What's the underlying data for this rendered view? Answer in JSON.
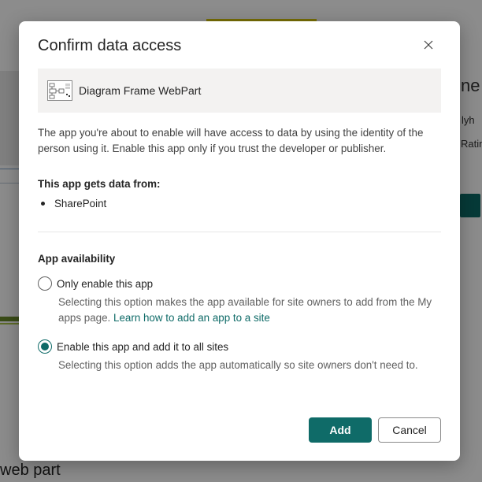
{
  "background": {
    "right_text_1": "ne W",
    "right_text_2": "lyh",
    "right_text_3": "Ratin",
    "bottom_text": "web part"
  },
  "dialog": {
    "title": "Confirm data access",
    "close_icon": "close-icon",
    "app": {
      "icon": "diagram-icon",
      "name": "Diagram Frame WebPart"
    },
    "description": "The app you're about to enable will have access to data by using the identity of the person using it. Enable this app only if you trust the developer or publisher.",
    "data_sources_heading": "This app gets data from:",
    "data_sources": [
      "SharePoint"
    ],
    "availability": {
      "heading": "App availability",
      "options": [
        {
          "label": "Only enable this app",
          "description": "Selecting this option makes the app available for site owners to add from the My apps page.",
          "link_text": "Learn how to add an app to a site",
          "selected": false
        },
        {
          "label": "Enable this app and add it to all sites",
          "description": "Selecting this option adds the app automatically so site owners don't need to.",
          "selected": true
        }
      ]
    },
    "buttons": {
      "add_label": "Add",
      "cancel_label": "Cancel"
    }
  },
  "colors": {
    "accent": "#0f6b68",
    "overlay": "rgba(0,0,0,0.45)",
    "card_bg": "#f3f2f1"
  }
}
